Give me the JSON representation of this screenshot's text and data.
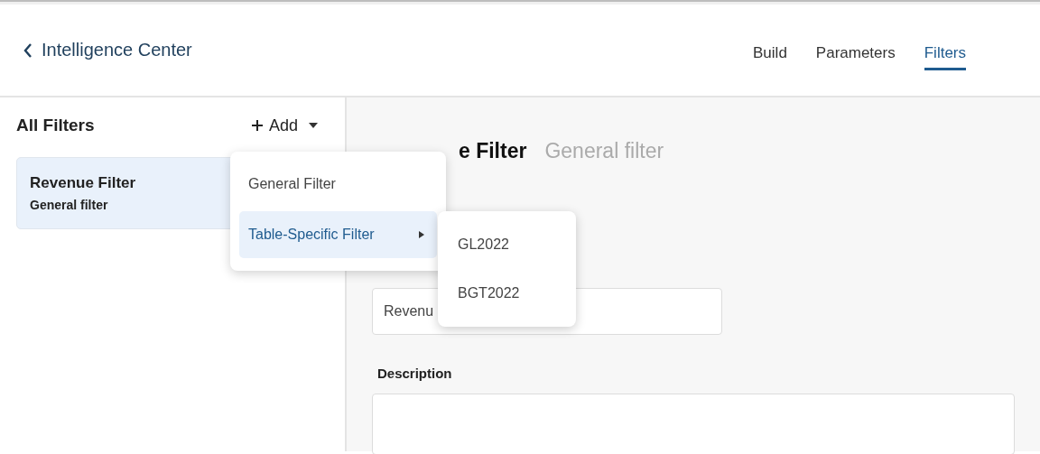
{
  "header": {
    "back_label": "Intelligence Center",
    "tabs": [
      {
        "label": "Build",
        "selected": false
      },
      {
        "label": "Parameters",
        "selected": false
      },
      {
        "label": "Filters",
        "selected": true
      }
    ]
  },
  "sidebar": {
    "title": "All Filters",
    "add_label": "Add",
    "items": [
      {
        "name": "Revenue Filter",
        "type": "General filter",
        "selected": true
      }
    ]
  },
  "detail": {
    "title_visible": "e Filter",
    "subtitle": "General filter",
    "name_value_visible": "Revenu",
    "description_label": "Description"
  },
  "add_menu": {
    "items": [
      {
        "label": "General Filter",
        "selected": false,
        "submenu": false
      },
      {
        "label": "Table-Specific Filter",
        "selected": true,
        "submenu": true
      }
    ]
  },
  "submenu": {
    "items": [
      {
        "label": "GL2022"
      },
      {
        "label": "BGT2022"
      }
    ]
  }
}
